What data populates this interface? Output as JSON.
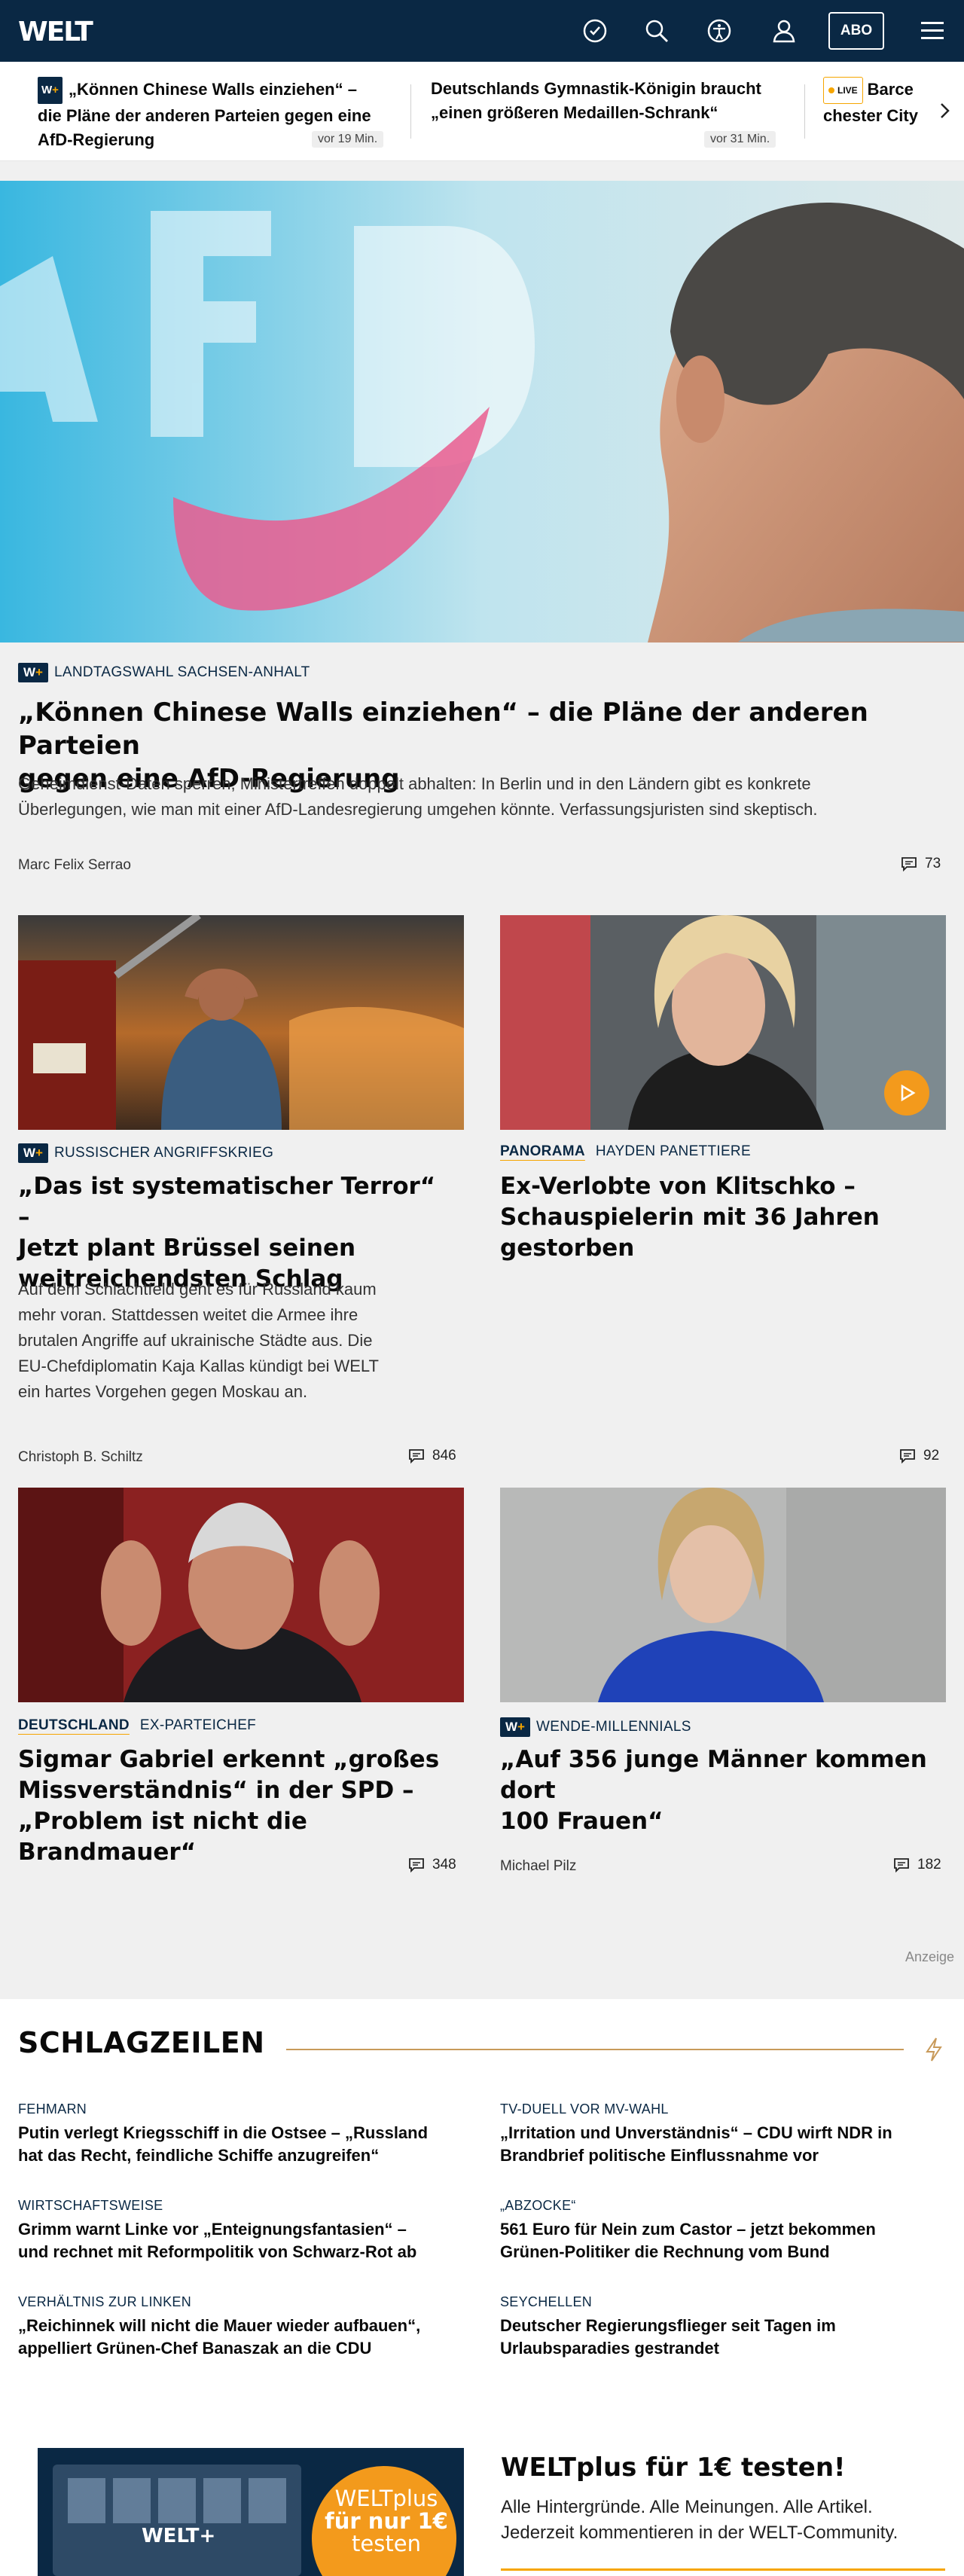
{
  "nav": {
    "logo": "WELT",
    "abo_label": "ABO",
    "icons": [
      "clock-icon",
      "search-icon",
      "accessibility-icon",
      "user-icon",
      "menu-icon"
    ]
  },
  "ticker": {
    "items": [
      {
        "premium": "W+",
        "title_line1": "„Können Chinese Walls einziehen“ –",
        "title_line2": "die Pläne der anderen Parteien gegen eine",
        "title_line3": "AfD-Regierung",
        "time": "vor 19 Min."
      },
      {
        "title_line1": "Deutschlands Gymnastik-Königin braucht",
        "title_line2": "„einen größeren Medaillen-Schrank“",
        "time": "vor 31 Min."
      },
      {
        "live": "LIVE",
        "title_line1": "Barce",
        "title_line2": "chester City"
      }
    ]
  },
  "hero": {
    "premium": "W+",
    "kicker": "LANDTAGSWAHL SACHSEN-ANHALT",
    "headline_line1": "„Können Chinese Walls einziehen“ – die Pläne der anderen Parteien",
    "headline_line2": "gegen eine AfD-Regierung",
    "teaser_line1": "Geheimdienst-Daten sperren, Ministertreffen doppelt abhalten: In Berlin und in den Ländern gibt es konkrete",
    "teaser_line2": "Überlegungen, wie man mit einer AfD-Landesregierung umgehen könnte. Verfassungsjuristen sind skeptisch.",
    "author": "Marc Felix Serrao",
    "comments": "73"
  },
  "cards": [
    {
      "premium": "W+",
      "kicker": "RUSSISCHER ANGRIFFSKRIEG",
      "headline_line1": "„Das ist systematischer Terror“ –",
      "headline_line2": "Jetzt plant Brüssel seinen",
      "headline_line3": "weitreichendsten Schlag",
      "teaser_line1": "Auf dem Schlachtfeld geht es für Russland kaum",
      "teaser_line2": "mehr voran. Stattdessen weitet die Armee ihre",
      "teaser_line3": "brutalen Angriffe auf ukrainische Städte aus. Die",
      "teaser_line4": "EU-Chefdiplomatin Kaja Kallas kündigt bei WELT",
      "teaser_line5": "ein hartes Vorgehen gegen Moskau an.",
      "author": "Christoph B. Schiltz",
      "comments": "846"
    },
    {
      "dept": "PANORAMA",
      "kicker": "HAYDEN PANETTIERE",
      "headline_line1": "Ex-Verlobte von Klitschko –",
      "headline_line2": "Schauspielerin mit 36 Jahren",
      "headline_line3": "gestorben",
      "comments": "92"
    },
    {
      "dept": "DEUTSCHLAND",
      "kicker": "EX-PARTEICHEF",
      "headline_line1": "Sigmar Gabriel erkennt „großes",
      "headline_line2": "Missverständnis“ in der SPD –",
      "headline_line3": "„Problem ist nicht die Brandmauer“",
      "comments": "348"
    },
    {
      "premium": "W+",
      "kicker": "WENDE-MILLENNIALS",
      "headline_line1": "„Auf 356 junge Männer kommen dort",
      "headline_line2": "100 Frauen“",
      "author": "Michael Pilz",
      "comments": "182"
    }
  ],
  "ad_label": "Anzeige",
  "schlagzeilen": {
    "title": "SCHLAGZEILEN",
    "items": [
      {
        "kicker": "FEHMARN",
        "line1": "Putin verlegt Kriegsschiff in die Ostsee – „Russland",
        "line2": "hat das Recht, feindliche Schiffe anzugreifen“"
      },
      {
        "kicker": "TV-DUELL VOR MV-WAHL",
        "line1": "„Irritation und Unverständnis“ – CDU wirft NDR in",
        "line2": "Brandbrief politische Einflussnahme vor"
      },
      {
        "kicker": "WIRTSCHAFTSWEISE",
        "line1": "Grimm warnt Linke vor „Enteignungsfantasien“ –",
        "line2": "und rechnet mit Reformpolitik von Schwarz-Rot ab"
      },
      {
        "kicker": "„ABZOCKE“",
        "line1": "561 Euro für Nein zum Castor – jetzt bekommen",
        "line2": "Grünen-Politiker die Rechnung vom Bund"
      },
      {
        "kicker": "VERHÄLTNIS ZUR LINKEN",
        "line1": "„Reichinnek will nicht die Mauer wieder aufbauen“,",
        "line2": "appelliert Grünen-Chef Banaszak an die CDU"
      },
      {
        "kicker": "SEYCHELLEN",
        "line1": "Deutscher Regierungsflieger seit Tagen im",
        "line2": "Urlaubsparadies gestrandet"
      }
    ]
  },
  "promo": {
    "badge_line1": "WELTplus",
    "badge_line2": "für nur 1€",
    "badge_line3": "testen",
    "device_logo": "WELT+",
    "title": "WELTplus für 1€ testen!",
    "text_line1": "Alle Hintergründe. Alle Meinungen. Alle Artikel.",
    "text_line2": "Jederzeit kommentieren in der WELT-Community."
  },
  "colors": {
    "navy": "#0a2844",
    "accent": "#f6a500",
    "bg": "#f0f0f0"
  }
}
